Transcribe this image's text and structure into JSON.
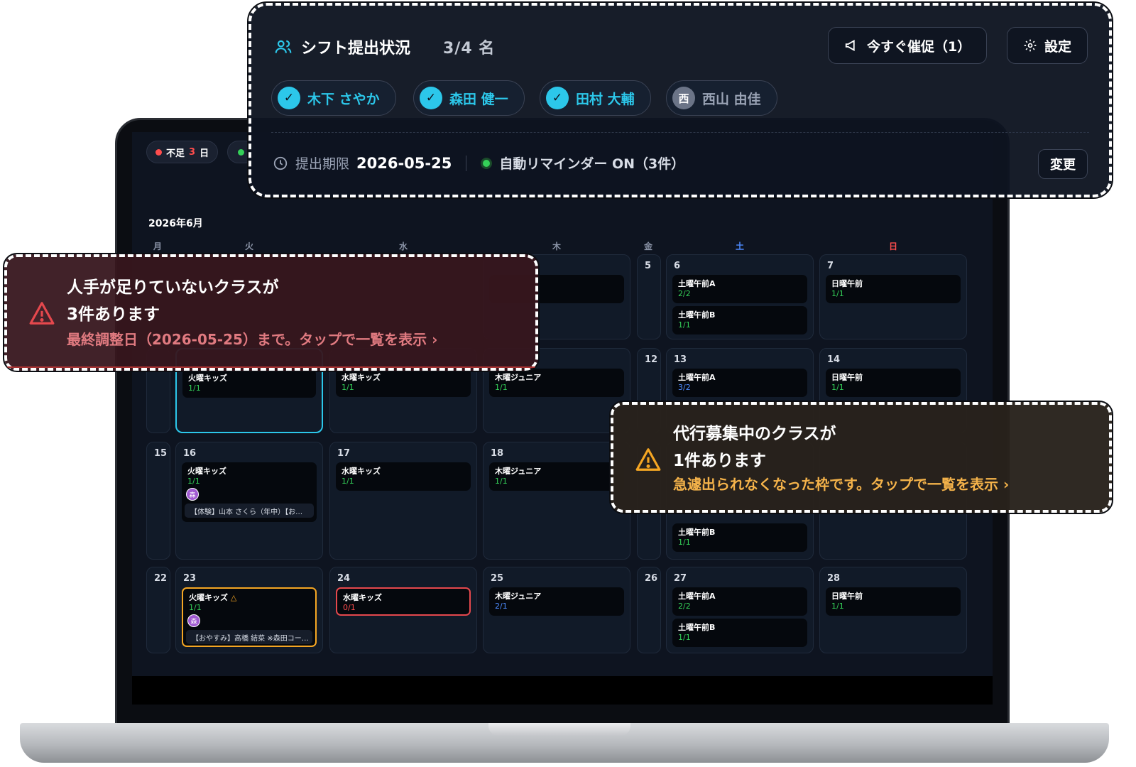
{
  "screen": {
    "chips": {
      "shortage_label": "不足",
      "shortage_count": "3",
      "shortage_unit": "日"
    },
    "month": "2026年6月",
    "weekdays": [
      "月",
      "火",
      "水",
      "木",
      "金",
      "土",
      "日"
    ],
    "days": {
      "d5": "5",
      "d6": "6",
      "d7": "7",
      "d12": "12",
      "d13": "13",
      "d14": "14",
      "d15": "15",
      "d16": "16",
      "d17": "17",
      "d18": "18",
      "d22": "22",
      "d23": "23",
      "d24": "24",
      "d25": "25",
      "d26": "26",
      "d27": "27",
      "d28": "28"
    },
    "classes": {
      "sat_a": "土曜午前A",
      "sat_b": "土曜午前B",
      "sun": "日曜午前",
      "tue": "火曜キッズ",
      "wed": "水曜キッズ",
      "thu": "木曜ジュニア"
    },
    "counts": {
      "c22": "2/2",
      "c11": "1/1",
      "c32": "3/2",
      "c01": "0/1",
      "c21": "2/1"
    },
    "avatar_initial": "森",
    "notes": {
      "n16": "【体験】山本 さくら（年中）【お…",
      "n23": "【おやすみ】高橋 結菜 ※森田コー…"
    }
  },
  "submission_panel": {
    "title": "シフト提出状況",
    "count": "3/4 名",
    "remind_button": "今すぐ催促（1）",
    "settings_button": "設定",
    "staff": [
      {
        "name": "木下 さやか",
        "status": "submitted"
      },
      {
        "name": "森田 健一",
        "status": "submitted"
      },
      {
        "name": "田村 大輔",
        "status": "submitted"
      },
      {
        "name": "西山 由佳",
        "status": "pending",
        "initial": "西"
      }
    ],
    "deadline_label": "提出期限",
    "deadline_value": "2026-05-25",
    "reminder_text": "自動リマインダー ON（3件）",
    "change_button": "変更"
  },
  "alert_shortage": {
    "title_line1": "人手が足りていないクラスが",
    "title_line2": "3件あります",
    "subtitle": "最終調整日（2026-05-25）まで。タップで一覧を表示 ›",
    "accent": "#e5484d"
  },
  "alert_substitute": {
    "title_line1": "代行募集中のクラスが",
    "title_line2": "1件あります",
    "subtitle": "急遽出られなくなった枠です。タップで一覧を表示 ›",
    "accent": "#f5a623"
  }
}
